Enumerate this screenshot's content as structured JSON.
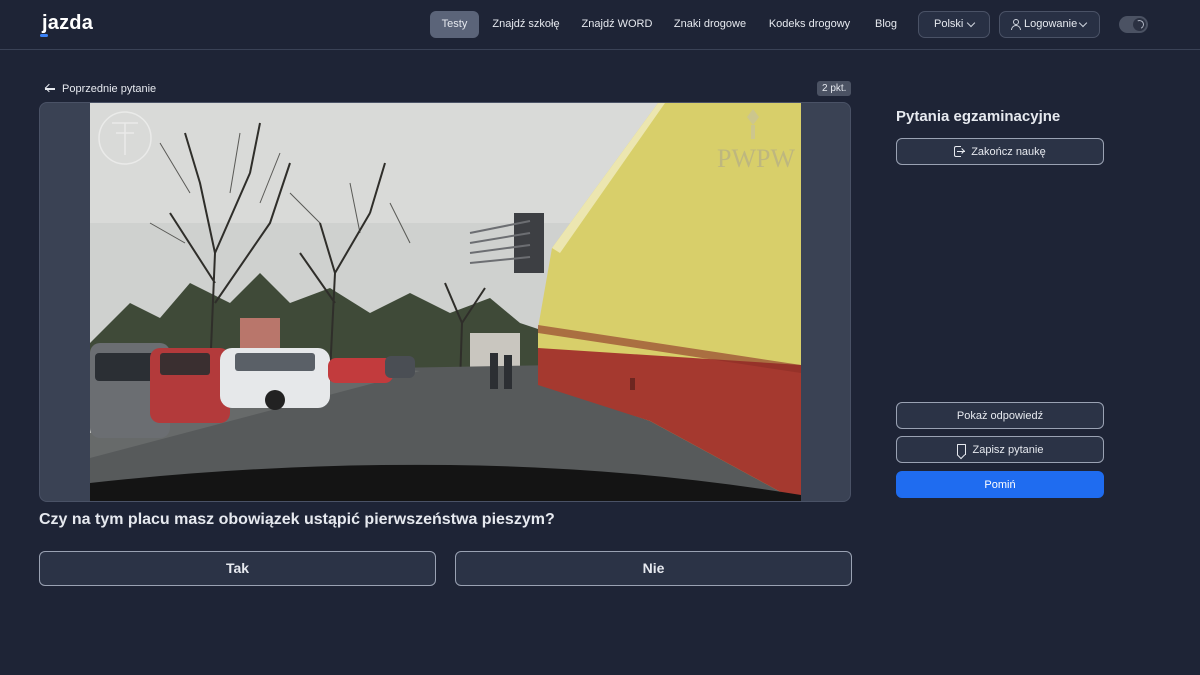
{
  "header": {
    "logo": "jazda",
    "nav": [
      {
        "label": "Testy",
        "active": true
      },
      {
        "label": "Znajdź szkołę",
        "active": false
      },
      {
        "label": "Znajdź WORD",
        "active": false
      },
      {
        "label": "Znaki drogowe",
        "active": false
      },
      {
        "label": "Kodeks drogowy",
        "active": false
      },
      {
        "label": "Blog",
        "active": false
      }
    ],
    "language_label": "Polski",
    "login_label": "Logowanie",
    "theme_toggle_icon": "moon-icon"
  },
  "question_panel": {
    "back_label": "Poprzednie pytanie",
    "points_label": "2 pkt.",
    "media_watermark": "PWPW",
    "question_text": "Czy na tym placu masz obowiązek ustąpić pierwszeństwa pieszym?",
    "answers": [
      {
        "label": "Tak"
      },
      {
        "label": "Nie"
      }
    ]
  },
  "sidebar": {
    "title": "Pytania egzaminacyjne",
    "end_study_label": "Zakończ naukę",
    "show_answer_label": "Pokaż odpowiedź",
    "save_question_label": "Zapisz pytanie",
    "skip_label": "Pomiń"
  },
  "colors": {
    "background": "#1e2436",
    "accent": "#1f6cf0",
    "active_nav": "#5b6479"
  }
}
